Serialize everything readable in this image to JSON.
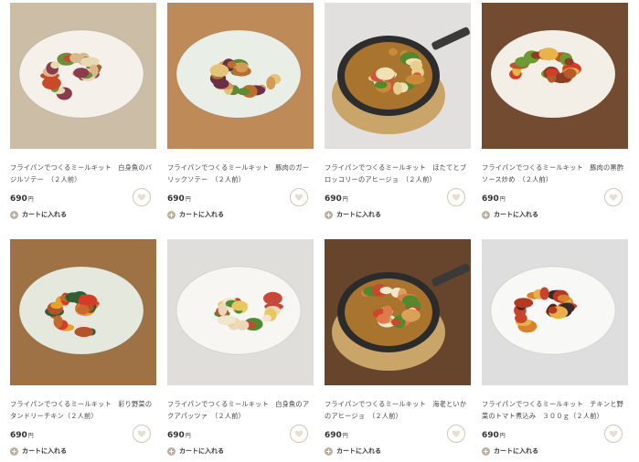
{
  "products": [
    {
      "title": "フライパンでつくるミールキット　白身魚のバジルソテー　（２人前）",
      "price": "690",
      "yen": "円",
      "cart": "カートに入れる",
      "bg": "#d9c9b1",
      "plate": "#f5f1ea",
      "plate_type": "round",
      "food": [
        "#d9b98a",
        "#6b8f3a",
        "#8a3c4e",
        "#c94a2a",
        "#e8d8b4"
      ]
    },
    {
      "title": "フライパンでつくるミールキット　豚肉のガーリックソテー　（２人前）",
      "price": "690",
      "yen": "円",
      "cart": "カートに入れる",
      "bg": "#c9935e",
      "plate": "#e9eee6",
      "plate_type": "round",
      "food": [
        "#d49a56",
        "#5e8a31",
        "#6a2f44",
        "#e3c27a",
        "#b8702f"
      ]
    },
    {
      "title": "フライパンでつくるミールキット　ほたてとブロッコリーのアヒージョ　（２人前）",
      "price": "690",
      "yen": "円",
      "cart": "カートに入れる",
      "bg": "#f1efec",
      "plate": "#2d2d2d",
      "plate_type": "pan",
      "food": [
        "#e9cf8f",
        "#4f8a2d",
        "#d0553a",
        "#f1e1b5",
        "#c98b3a"
      ]
    },
    {
      "title": "フライパンでつくるミールキット　豚肉の黒酢ソース炒め　（２人前）",
      "price": "690",
      "yen": "円",
      "cart": "カートに入れる",
      "bg": "#7a5035",
      "plate": "#f3efe6",
      "plate_type": "round",
      "food": [
        "#b65a2b",
        "#d43b2b",
        "#6e9a32",
        "#e8b347",
        "#8a3f24"
      ]
    },
    {
      "title": "フライパンでつくるミールキット　彩り野菜のタンドリーチキン（２人前）",
      "price": "690",
      "yen": "円",
      "cart": "カートに入れる",
      "bg": "#a87a4a",
      "plate": "#e5e8dc",
      "plate_type": "round",
      "food": [
        "#c7692e",
        "#e2a12f",
        "#2f5e33",
        "#d43c27",
        "#b45228"
      ]
    },
    {
      "title": "フライパンでつくるミールキット　白身魚のアクアパッツァ　（２人前）",
      "price": "690",
      "yen": "円",
      "cart": "カートに入れる",
      "bg": "#eeece8",
      "plate": "#f7f6f2",
      "plate_type": "round",
      "food": [
        "#ead8b8",
        "#4e8c2f",
        "#e6c85d",
        "#c9473a",
        "#f1e5cd"
      ]
    },
    {
      "title": "フライパンでつくるミールキット　海老といかのアヒージョ　（２人前）",
      "price": "690",
      "yen": "円",
      "cart": "カートに入れる",
      "bg": "#6e4a2f",
      "plate": "#2b2b2b",
      "plate_type": "pan",
      "food": [
        "#e07a4a",
        "#f2e6cf",
        "#4f8a2d",
        "#d9a257",
        "#c94a2a"
      ]
    },
    {
      "title": "フライパンでつくるミールキット　チキンと野菜のトマト煮込み　３００ｇ（２人前）",
      "price": "690",
      "yen": "円",
      "cart": "カートに入れる",
      "bg": "#ececec",
      "plate": "#f8f8f6",
      "plate_type": "round",
      "food": [
        "#c8442a",
        "#d9822e",
        "#3a2a2a",
        "#e8b04a",
        "#b23a22"
      ]
    }
  ]
}
